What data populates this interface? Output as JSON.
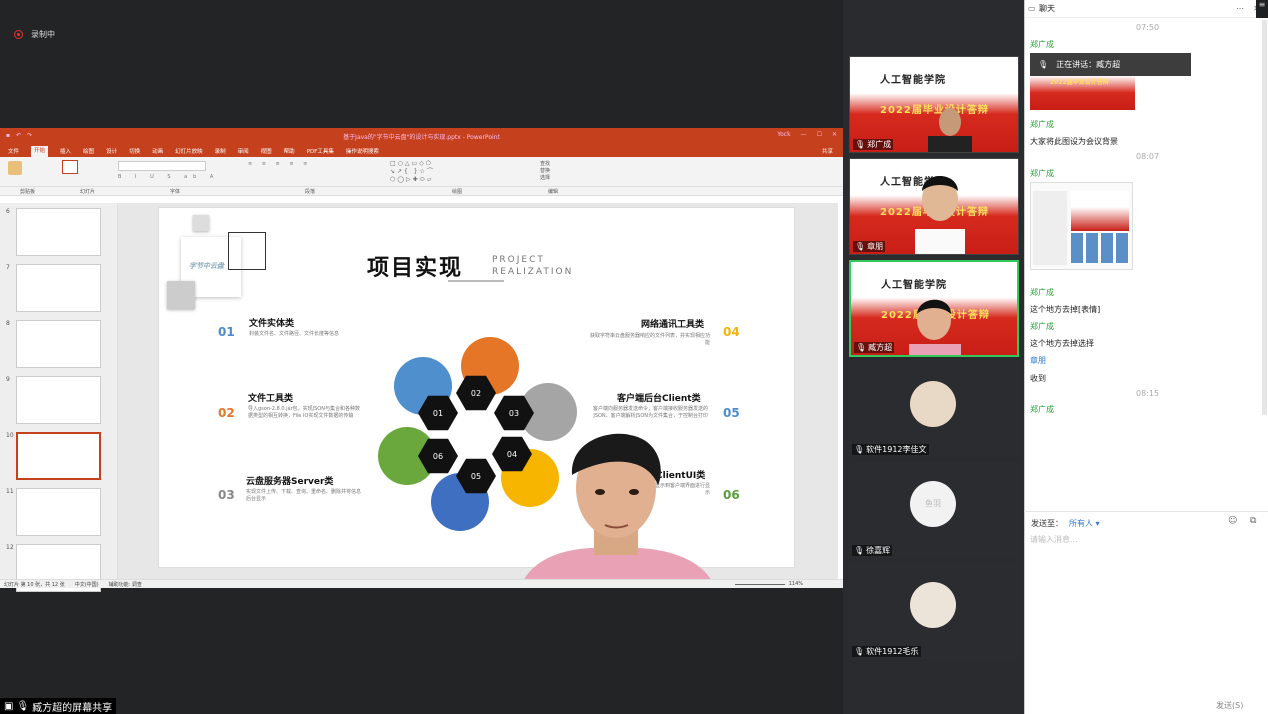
{
  "recording": {
    "label": "录制中"
  },
  "share": {
    "label": "臧方超的屏幕共享"
  },
  "ppt": {
    "title": "基于Java的\"字节中云盘\"的设计与实现.pptx  -  PowerPoint",
    "user": "Yock",
    "share_btn": "共享",
    "tabs": [
      "文件",
      "开始",
      "插入",
      "绘图",
      "设计",
      "切换",
      "动画",
      "幻灯片放映",
      "录制",
      "审阅",
      "视图",
      "帮助",
      "PDF工具集",
      "操作说明搜索"
    ],
    "ribbon_groups": [
      "剪贴板",
      "幻灯片",
      "字体",
      "段落",
      "绘图",
      "编辑"
    ],
    "status_left": "幻灯片 第 10 张，共 12 张",
    "status_lang": "中文(中国)",
    "status_access": "辅助功能: 调查",
    "status_zoom": "114%",
    "thumb_numbers": [
      "6",
      "7",
      "8",
      "9",
      "10",
      "11",
      "12"
    ]
  },
  "slide": {
    "title": "项目实现",
    "sub1": "PROJECT",
    "sub2": "REALIZATION",
    "logo": "字节中云盘",
    "items": [
      {
        "num": "01",
        "head": "文件实体类",
        "desc": "封装文件名、文件路径、文件长度等信息"
      },
      {
        "num": "02",
        "head": "文件工具类",
        "desc": "导入gson-2.8.0.jar包，实现JSON与集合和各种数据类型的相互转换，File IO实现文件数据的传输"
      },
      {
        "num": "03",
        "head": "云盘服务器Server类",
        "desc": "实现文件上传、下载、查询、重命名、删除并将信息后台显示"
      },
      {
        "num": "04",
        "head": "网络通讯工具类",
        "desc": "获取字符串云盘服务器响应的文件列表，并实现相应功能"
      },
      {
        "num": "05",
        "head": "客户端后台Client类",
        "desc": "客户端向服务器发送命令，客户端接收服务器发送的JSON，客户端解析JSON为文件集合，于控制台打印"
      },
      {
        "num": "06",
        "head": "ClientUI类",
        "desc": "将数据显示到客户端界面进行显示"
      }
    ],
    "hex": [
      "01",
      "02",
      "03",
      "04",
      "05",
      "06"
    ]
  },
  "participants": [
    {
      "name": "郑广成",
      "banner_top": "人工智能学院",
      "banner_bottom": "2022届毕业设计答辩"
    },
    {
      "name": "章朋",
      "banner_top": "人工智能学院",
      "banner_bottom": "2022届毕业设计答辩"
    },
    {
      "name": "臧方超",
      "banner_top": "人工智能学院",
      "banner_bottom": "2022届毕业设计答辩"
    },
    {
      "name": "软件1912李佳文"
    },
    {
      "name": "徐嘉辉",
      "avatar_text": "鱼羽"
    },
    {
      "name": "软件1912毛乐"
    }
  ],
  "chat": {
    "title": "聊天",
    "speaking": "正在讲话：臧方超",
    "messages": [
      {
        "type": "time",
        "text": "07:50"
      },
      {
        "type": "name",
        "text": "郑广成"
      },
      {
        "type": "image",
        "text": "2022届毕业设计答辩"
      },
      {
        "type": "name",
        "text": "郑广成"
      },
      {
        "type": "text",
        "text": "大家将此图设为会议背景"
      },
      {
        "type": "time",
        "text": "08:07"
      },
      {
        "type": "name",
        "text": "郑广成"
      },
      {
        "type": "name",
        "text": "郑广成"
      },
      {
        "type": "text",
        "text": "这个地方去掉[表情]"
      },
      {
        "type": "name",
        "text": "郑广成"
      },
      {
        "type": "text",
        "text": "这个地方去掉选择"
      },
      {
        "type": "name",
        "text": "章朋"
      },
      {
        "type": "text",
        "text": "收到"
      },
      {
        "type": "time",
        "text": "08:15"
      },
      {
        "type": "name",
        "text": "郑广成"
      }
    ],
    "send_to_label": "发送至：",
    "send_to_value": "所有人",
    "input_placeholder": "请输入消息...",
    "send_button": "发送(S)"
  }
}
